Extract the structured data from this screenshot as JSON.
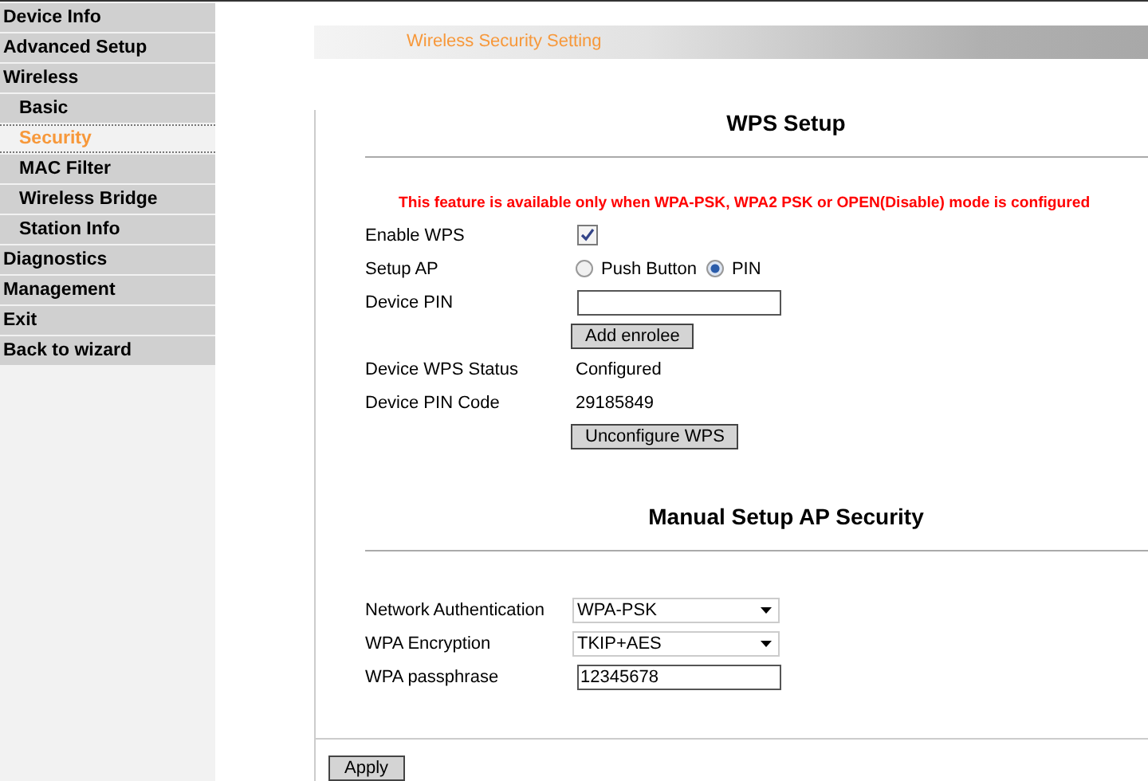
{
  "sidebar": {
    "items": [
      {
        "label": "Device Info",
        "selected": false
      },
      {
        "label": "Advanced Setup",
        "selected": false
      },
      {
        "label": "Wireless",
        "selected": false,
        "children": [
          {
            "label": "Basic",
            "selected": false
          },
          {
            "label": "Security",
            "selected": true
          },
          {
            "label": "MAC Filter",
            "selected": false
          },
          {
            "label": "Wireless Bridge",
            "selected": false
          },
          {
            "label": "Station Info",
            "selected": false
          }
        ]
      },
      {
        "label": "Diagnostics",
        "selected": false
      },
      {
        "label": "Management",
        "selected": false
      },
      {
        "label": "Exit",
        "selected": false
      },
      {
        "label": "Back to wizard",
        "selected": false
      }
    ]
  },
  "header": {
    "title": "Wireless Security Setting"
  },
  "sections": [
    {
      "title": "WPS Setup",
      "notice": "This feature is available only when WPA-PSK, WPA2 PSK or OPEN(Disable) mode is configured",
      "rows": [
        {
          "kind": "checkbox",
          "label": "Enable WPS",
          "checked": true
        },
        {
          "kind": "radio",
          "label": "Setup AP",
          "options": [
            {
              "label": "Push Button",
              "selected": false
            },
            {
              "label": "PIN",
              "selected": true
            }
          ]
        },
        {
          "kind": "input",
          "label": "Device PIN",
          "value": ""
        },
        {
          "kind": "button",
          "label": "Add enrolee"
        },
        {
          "kind": "text",
          "label": "Device WPS Status",
          "value": "Configured"
        },
        {
          "kind": "text",
          "label": "Device PIN Code",
          "value": "29185849"
        },
        {
          "kind": "button",
          "label": "Unconfigure WPS"
        }
      ]
    },
    {
      "title": "Manual Setup AP Security",
      "rows": [
        {
          "kind": "select",
          "label": "Network Authentication",
          "value": "WPA-PSK"
        },
        {
          "kind": "select",
          "label": "WPA Encryption",
          "value": "TKIP+AES"
        },
        {
          "kind": "input",
          "label": "WPA passphrase",
          "value": "12345678"
        }
      ]
    }
  ],
  "apply_button": "Apply"
}
